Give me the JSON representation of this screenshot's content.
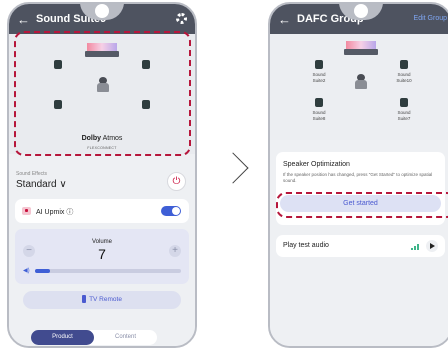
{
  "left": {
    "header": {
      "title": "Sound Suite9"
    },
    "stage": {
      "brand": "Dolby",
      "brand_suffix": " Atmos",
      "tagline": "FLEXCONNECT"
    },
    "sound_effects": {
      "label": "Sound Effects",
      "value": "Standard ∨"
    },
    "upmix": {
      "label": "AI Upmix ⓘ",
      "enabled": true
    },
    "volume": {
      "label": "Volume",
      "value": "7",
      "minus": "−",
      "plus": "+",
      "level_fraction": 0.1
    },
    "tv_remote": {
      "label": "TV Remote"
    },
    "tabs": [
      {
        "label": "Product",
        "active": true
      },
      {
        "label": "Content",
        "active": false
      }
    ]
  },
  "right": {
    "header": {
      "title": "DAFC Group",
      "edit": "Edit Group"
    },
    "speakers": [
      {
        "name": "Sound Suite2"
      },
      {
        "name": "Sound Suite10"
      },
      {
        "name": "Sound Suite8"
      },
      {
        "name": "Sound Suite7"
      }
    ],
    "optimization": {
      "title": "Speaker Optimization",
      "description": "If the speaker position has changed, press \"Get Started\" to optimize spatial sound.",
      "button": "Get started"
    },
    "test_audio": {
      "label": "Play test audio"
    }
  },
  "colors": {
    "header_bg": "#4e5360",
    "accent": "#3f5fd6",
    "highlight": "#b6163b"
  }
}
